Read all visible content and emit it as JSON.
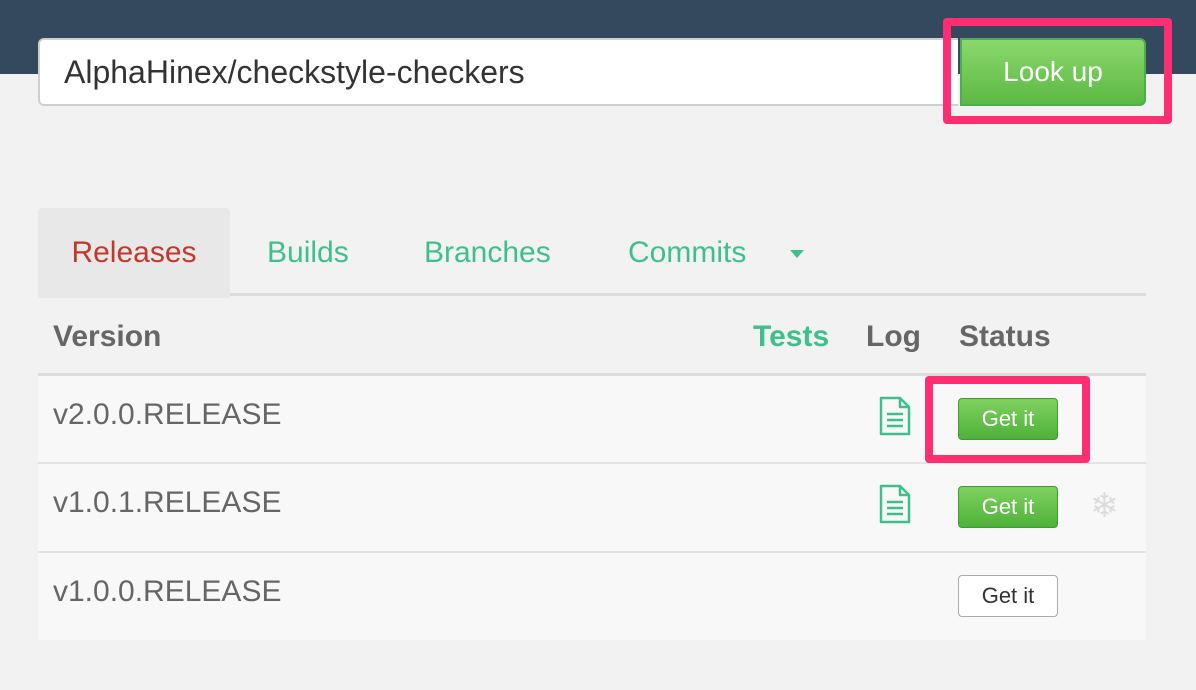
{
  "search": {
    "value": "AlphaHinex/checkstyle-checkers",
    "button_label": "Look up"
  },
  "tabs": [
    {
      "label": "Releases",
      "active": true
    },
    {
      "label": "Builds",
      "active": false
    },
    {
      "label": "Branches",
      "active": false
    },
    {
      "label": "Commits",
      "active": false
    }
  ],
  "table": {
    "headers": {
      "version": "Version",
      "tests": "Tests",
      "log": "Log",
      "status": "Status"
    },
    "rows": [
      {
        "version": "v2.0.0.RELEASE",
        "log": true,
        "button": "Get it",
        "button_style": "green",
        "extra_icon": ""
      },
      {
        "version": "v1.0.1.RELEASE",
        "log": true,
        "button": "Get it",
        "button_style": "green",
        "extra_icon": "snowflake-icon"
      },
      {
        "version": "v1.0.0.RELEASE",
        "log": false,
        "button": "Get it",
        "button_style": "default",
        "extra_icon": ""
      }
    ]
  },
  "icons": {
    "log": "document-icon",
    "caret": "caret-down-icon",
    "snowflake": "snowflake-icon",
    "snowflake_glyph": "❄"
  },
  "colors": {
    "topbar": "#34495e",
    "accent_green": "#3dbf8e",
    "active_tab": "#c0392b",
    "button_green": "#5cb944",
    "highlight": "#ff2d72"
  }
}
